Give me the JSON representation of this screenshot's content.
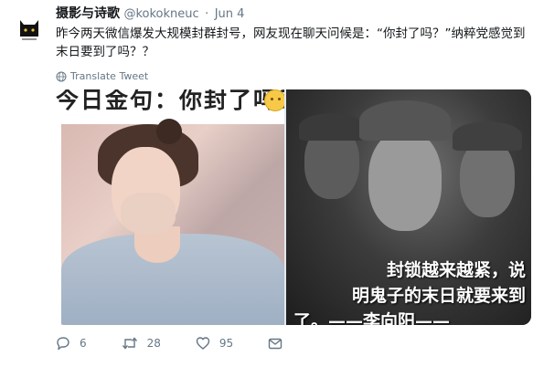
{
  "tweet": {
    "author_name": "摄影与诗歌",
    "author_handle": "@kokokneuc",
    "separator": "·",
    "date": "Jun 4",
    "text": "昨今两天微信爆发大规模封群封号，网友现在聊天问候是：“你封了吗？”纳粹党感觉到末日要到了吗？？",
    "translate_label": "Translate Tweet"
  },
  "media": {
    "left_caption": "今日金句：你封了吗？",
    "right_caption_lines": [
      "封锁越来越紧，说",
      "明鬼子的末日就要来到",
      "了。——李向阳——"
    ]
  },
  "actions": {
    "replies": "6",
    "retweets": "28",
    "likes": "95"
  },
  "colors": {
    "muted": "#657786",
    "text": "#14171a"
  }
}
